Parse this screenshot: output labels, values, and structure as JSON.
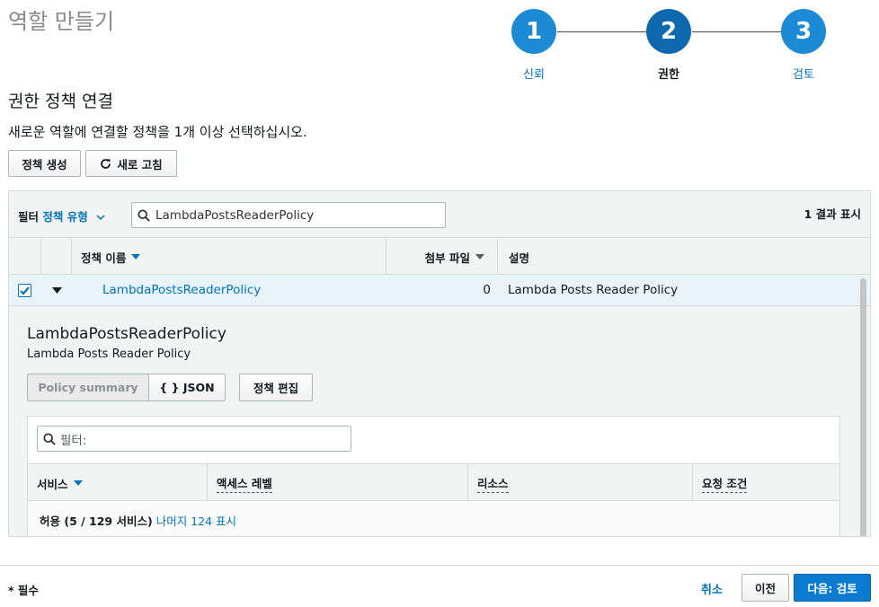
{
  "page": {
    "title": "역할 만들기"
  },
  "stepper": {
    "steps": [
      {
        "number": "1",
        "label": "신뢰",
        "color": "#1d8ad6",
        "label_color": "#0073bb"
      },
      {
        "number": "2",
        "label": "권한",
        "color": "#0d68ad",
        "label_color": "#16191f"
      },
      {
        "number": "3",
        "label": "검토",
        "color": "#1d8ad6",
        "label_color": "#0073bb"
      }
    ]
  },
  "section": {
    "title": "권한 정책 연결",
    "description": "새로운 역할에 연결할 정책을 1개 이상 선택하십시오."
  },
  "toolbar": {
    "create_policy": "정책 생성",
    "refresh": "새로 고침"
  },
  "filter": {
    "label": "필터",
    "type_label": "정책 유형",
    "search_value": "LambdaPostsReaderPolicy",
    "result_count": "1 결과 표시"
  },
  "table": {
    "columns": {
      "name": "정책 이름",
      "attachments": "첨부 파일",
      "description": "설명"
    },
    "rows": [
      {
        "name": "LambdaPostsReaderPolicy",
        "attachments": "0",
        "description": "Lambda Posts Reader Policy",
        "checked": true
      }
    ]
  },
  "detail": {
    "title": "LambdaPostsReaderPolicy",
    "subtitle": "Lambda Posts Reader Policy",
    "tabs": {
      "summary": "Policy summary",
      "json": "{ } JSON"
    },
    "edit_policy": "정책 편집",
    "filter_placeholder": "필터:",
    "columns": {
      "service": "서비스",
      "access_level": "액세스 레벨",
      "resource": "리소스",
      "condition": "요청 조건"
    },
    "allow_summary": "허용 (5 / 129 서비스)",
    "show_remaining": "나머지 124 표시"
  },
  "footer": {
    "required": "* 필수",
    "cancel": "취소",
    "previous": "이전",
    "next": "다음: 검토"
  },
  "colors": {
    "accent": "#0073bb",
    "primary_button": "#0a7bd0",
    "selected_row": "#e8f4fa"
  }
}
